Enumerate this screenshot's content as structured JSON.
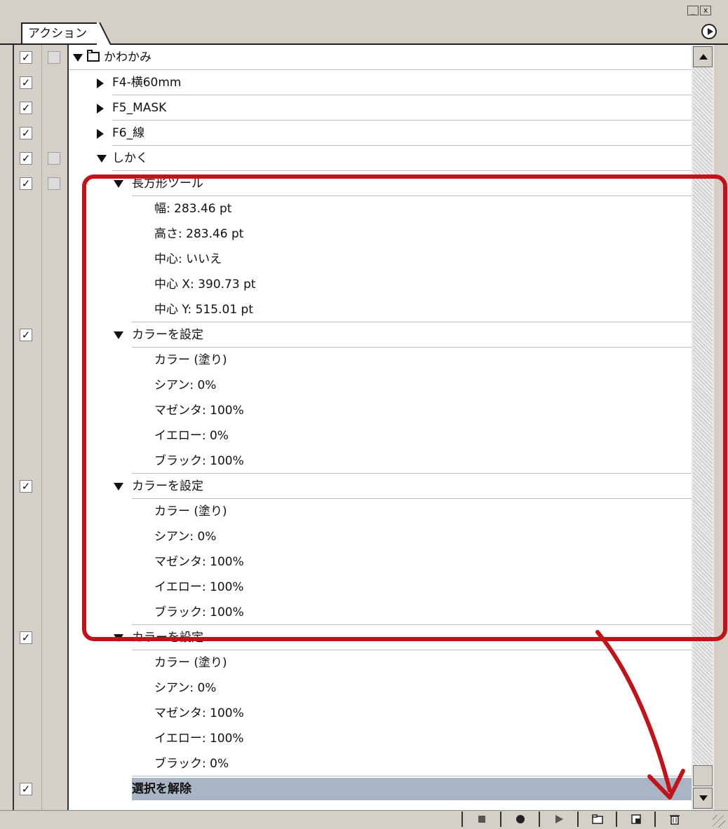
{
  "window": {
    "minimize_glyph": "_",
    "close_glyph": "x"
  },
  "panel": {
    "tab_label": "アクション",
    "menu_icon": "panel-menu-arrow-icon"
  },
  "rows": [
    {
      "type": "set",
      "label": "かわかみ",
      "check": "✓",
      "box2": true,
      "expanded": true,
      "indent": 0
    },
    {
      "type": "action",
      "label": "F4-横60mm",
      "check": "✓",
      "box2": false,
      "expanded": false,
      "indent": 1
    },
    {
      "type": "action",
      "label": "F5_MASK",
      "check": "✓",
      "box2": false,
      "expanded": false,
      "indent": 1
    },
    {
      "type": "action",
      "label": "F6_線",
      "check": "✓",
      "box2": false,
      "expanded": false,
      "indent": 1
    },
    {
      "type": "action",
      "label": "しかく",
      "check": "✓",
      "box2": true,
      "expanded": true,
      "indent": 1
    },
    {
      "type": "command",
      "label": "長方形ツール",
      "check": "✓",
      "box2": true,
      "expanded": true,
      "indent": 2
    },
    {
      "type": "param",
      "label": "幅: 283.46 pt",
      "indent": 3
    },
    {
      "type": "param",
      "label": "高さ: 283.46 pt",
      "indent": 3
    },
    {
      "type": "param",
      "label": "中心: いいえ",
      "indent": 3
    },
    {
      "type": "param",
      "label": "中心 X: 390.73 pt",
      "indent": 3
    },
    {
      "type": "param",
      "label": "中心 Y: 515.01 pt",
      "indent": 3,
      "last": true
    },
    {
      "type": "command",
      "label": "カラーを設定",
      "check": "✓",
      "box2": false,
      "expanded": true,
      "indent": 2
    },
    {
      "type": "param",
      "label": "カラー (塗り)",
      "indent": 3
    },
    {
      "type": "param",
      "label": "シアン: 0%",
      "indent": 3
    },
    {
      "type": "param",
      "label": "マゼンタ: 100%",
      "indent": 3
    },
    {
      "type": "param",
      "label": "イエロー: 0%",
      "indent": 3
    },
    {
      "type": "param",
      "label": "ブラック: 100%",
      "indent": 3,
      "last": true
    },
    {
      "type": "command",
      "label": "カラーを設定",
      "check": "✓",
      "box2": false,
      "expanded": true,
      "indent": 2
    },
    {
      "type": "param",
      "label": "カラー (塗り)",
      "indent": 3
    },
    {
      "type": "param",
      "label": "シアン: 0%",
      "indent": 3
    },
    {
      "type": "param",
      "label": "マゼンタ: 100%",
      "indent": 3
    },
    {
      "type": "param",
      "label": "イエロー: 100%",
      "indent": 3
    },
    {
      "type": "param",
      "label": "ブラック: 100%",
      "indent": 3,
      "last": true
    },
    {
      "type": "command",
      "label": "カラーを設定",
      "check": "✓",
      "box2": false,
      "expanded": true,
      "indent": 2
    },
    {
      "type": "param",
      "label": "カラー (塗り)",
      "indent": 3
    },
    {
      "type": "param",
      "label": "シアン: 0%",
      "indent": 3
    },
    {
      "type": "param",
      "label": "マゼンタ: 100%",
      "indent": 3
    },
    {
      "type": "param",
      "label": "イエロー: 100%",
      "indent": 3
    },
    {
      "type": "param",
      "label": "ブラック: 0%",
      "indent": 3,
      "last": true
    },
    {
      "type": "command",
      "label": "選択を解除",
      "check": "✓",
      "box2": false,
      "expanded": false,
      "indent": 2,
      "selected": true,
      "no_triangle": true
    }
  ],
  "toolbar": [
    {
      "name": "stop-button",
      "icon": "stop-icon"
    },
    {
      "name": "record-button",
      "icon": "record-icon"
    },
    {
      "name": "play-button",
      "icon": "play-icon"
    },
    {
      "name": "new-set-button",
      "icon": "folder-icon"
    },
    {
      "name": "new-action-button",
      "icon": "new-action-icon"
    },
    {
      "name": "delete-button",
      "icon": "trash-icon"
    }
  ],
  "colors": {
    "panel_bg": "#d4d0c8",
    "selected_row": "#a9b4c4",
    "annotation_red": "#c0141c"
  }
}
